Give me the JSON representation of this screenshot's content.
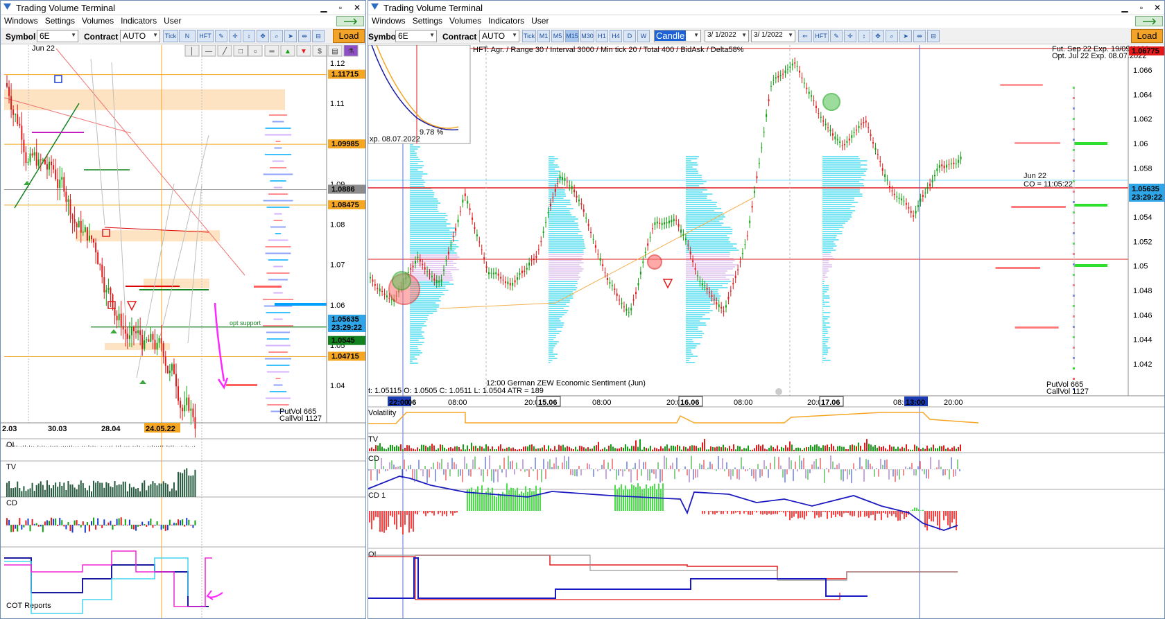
{
  "left": {
    "title": "Trading Volume Terminal",
    "menu": [
      "Windows",
      "Settings",
      "Volumes",
      "Indicators",
      "User"
    ],
    "symbol_label": "Symbol",
    "symbol_value": "6E",
    "contract_label": "Contract",
    "contract_value": "AUTO",
    "toolbar_buttons": [
      "Tick",
      "N",
      "HFT"
    ],
    "load_label": "Load",
    "contract_watermark": "Jun 22",
    "prices": [
      "1.12",
      "1.11",
      "1.09",
      "1.08",
      "1.07",
      "1.06",
      "1.05",
      "1.04"
    ],
    "price_tags": [
      {
        "label": "1.11715",
        "color": "#f5a623"
      },
      {
        "label": "1.09985",
        "color": "#f5a623"
      },
      {
        "label": "1.0886",
        "color": "#8c8c8c"
      },
      {
        "label": "1.08475",
        "color": "#f5a623"
      },
      {
        "label": "1.05635",
        "color": "#2fa6e8"
      },
      {
        "label": "23:29:22",
        "color": "#2fa6e8"
      },
      {
        "label": "1.0545",
        "color": "#12831e"
      },
      {
        "label": "1.04715",
        "color": "#f5a623"
      }
    ],
    "dates": [
      "2.03",
      "30.03",
      "28.04",
      "24.05.22"
    ],
    "putvol": "PutVol  665",
    "callvol": "CallVol  1127",
    "note_small": "opt support",
    "panels": [
      "OI",
      "TV",
      "CD",
      "COT Reports"
    ]
  },
  "right": {
    "title": "Trading Volume Terminal",
    "menu": [
      "Windows",
      "Settings",
      "Volumes",
      "Indicators",
      "User"
    ],
    "symbol_label": "Symbol",
    "symbol_value": "6E",
    "contract_label": "Contract",
    "contract_value": "AUTO",
    "timeframes": [
      "Tick",
      "M1",
      "M5",
      "M15",
      "M30",
      "H1",
      "H4",
      "D",
      "W"
    ],
    "chart_type": "Candle",
    "date_from": "3/ 1/2022",
    "date_to": "3/ 1/2022",
    "hft_label": "HFT",
    "load_label": "Load",
    "header_info": "HFT: Agr. / Range 30 / Interval 3000 / Min tick 20 / Total 400 / BidAsk / Delta58%",
    "fut_line": "Fut. Sep 22 Exp. 19/09/2022",
    "opt_line": "Opt. Jul 22 Exp. 08.07.2022",
    "top_tag": "1.06775",
    "curve_pct": "9.78 %",
    "curve_exp": "xp. 08.07.2022",
    "prices": [
      "1.066",
      "1.064",
      "1.062",
      "1.06",
      "1.058",
      "1.056",
      "1.054",
      "1.052",
      "1.05",
      "1.048",
      "1.046",
      "1.044",
      "1.042"
    ],
    "price_tag": "1.05635",
    "time_tag": "23:29:22",
    "jun_label": "Jun 22",
    "co_label": "CO = 11:05:22",
    "event": "12:00 German ZEW Economic Sentiment (Jun)",
    "ohlc": "t: 1.05115   O: 1.0505   C: 1.0511   L: 1.0504   ATR = 189",
    "times": [
      "22:00",
      "06",
      "08:00",
      "20:00",
      "15.06",
      "08:00",
      "20:00",
      "16.06",
      "08:00",
      "20:00",
      "17.06",
      "08:00",
      "13:00",
      "20:00"
    ],
    "putvol": "PutVol  665",
    "callvol": "CallVol  1127",
    "panels": [
      "Volatility",
      "TV",
      "CD",
      "CD 1",
      "OI"
    ]
  }
}
